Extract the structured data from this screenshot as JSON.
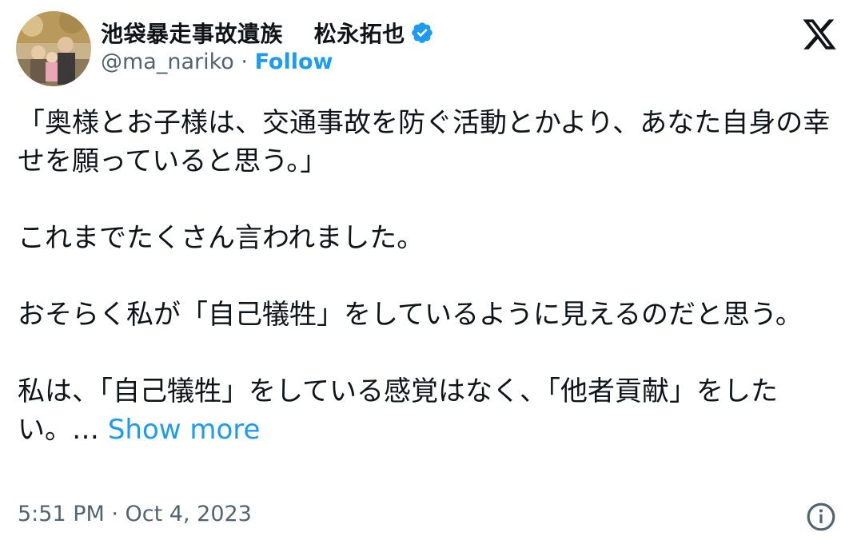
{
  "author": {
    "display_name": "池袋暴走事故遺族　 松永拓也",
    "handle": "@ma_nariko",
    "separator": " · ",
    "follow_label": "Follow"
  },
  "tweet": {
    "paragraphs": [
      "「奥様とお子様は、交通事故を防ぐ活動とかより、あなた自身の幸せを願っていると思う。」",
      "これまでたくさん言われました。",
      "おそらく私が「自己犠牲」をしているように見えるのだと思う。"
    ],
    "last_paragraph": "私は、「自己犠牲」をしている感覚はなく、「他者貢献」をしたい。…",
    "show_more_label": "Show more"
  },
  "footer": {
    "timestamp": "5:51 PM · Oct 4, 2023"
  },
  "icons": {
    "verified": "verified-badge-icon",
    "x_logo": "x-logo-icon",
    "info": "info-icon"
  },
  "colors": {
    "accent": "#1d9bf0",
    "muted": "#536471",
    "text": "#0f1419"
  }
}
